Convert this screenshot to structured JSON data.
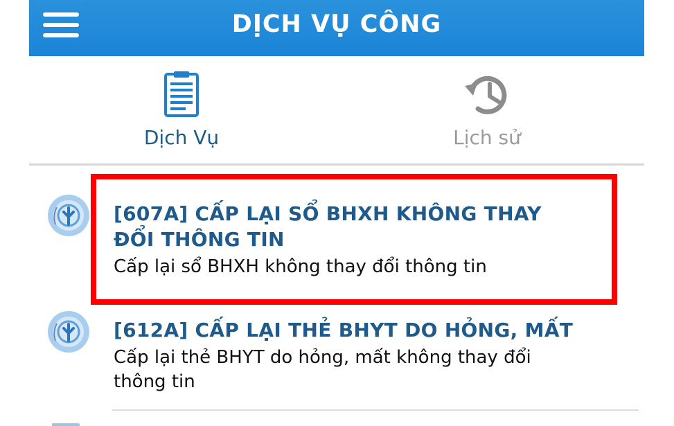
{
  "header": {
    "title": "DỊCH VỤ CÔNG",
    "background_color": "#1f88d8",
    "menu_icon": "menu-icon"
  },
  "tabs": [
    {
      "label": "Dịch Vụ",
      "icon": "clipboard-document-icon",
      "active": true,
      "color": "#1d5a86"
    },
    {
      "label": "Lịch sử",
      "icon": "history-icon",
      "active": false,
      "color": "#9a9a9a"
    }
  ],
  "services": [
    {
      "title": "[607A] CẤP LẠI SỔ BHXH KHÔNG THAY ĐỔI THÔNG TIN",
      "description": "Cấp lại sổ BHXH không thay đổi thông tin",
      "logo": "bhxh-logo-icon",
      "highlighted": true
    },
    {
      "title": "[612A] CẤP LẠI THẺ BHYT DO HỎNG, MẤT",
      "description": "Cấp lại thẻ BHYT do hỏng, mất không thay đổi thông tin",
      "logo": "bhxh-logo-icon",
      "highlighted": false
    }
  ],
  "highlight": {
    "color": "#ff0000"
  }
}
